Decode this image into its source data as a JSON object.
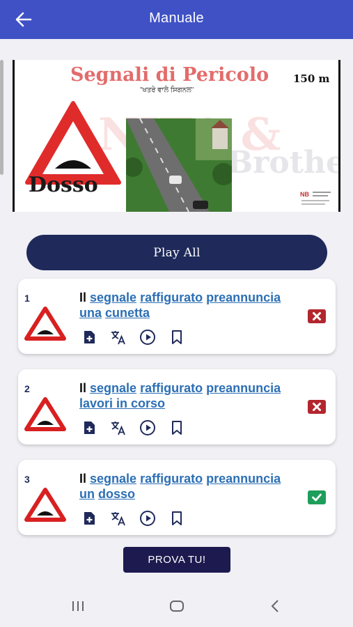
{
  "header": {
    "title": "Manuale"
  },
  "banner": {
    "title": "Segnali di Pericolo",
    "distance": "150 m",
    "subtitle": "\"ਖਤਰੇ ਵਾਲੇ ਸਿਗਨਲ\"",
    "sign_label": "Dosso",
    "watermark_line1": "NITA &",
    "watermark_line2": "Brothers"
  },
  "play_all_label": "Play All",
  "questions": [
    {
      "number": "1",
      "prefix": "Il",
      "words": [
        "segnale",
        "raffigurato",
        "preannuncia",
        "una",
        "cunetta"
      ],
      "status": "wrong"
    },
    {
      "number": "2",
      "prefix": "Il",
      "words": [
        "segnale",
        "raffigurato",
        "preannuncia",
        "lavori in corso"
      ],
      "status": "wrong"
    },
    {
      "number": "3",
      "prefix": "Il",
      "words": [
        "segnale",
        "raffigurato",
        "preannuncia",
        "un",
        "dosso"
      ],
      "status": "correct"
    }
  ],
  "prova_label": "PROVA TU!",
  "colors": {
    "appbar": "#3f51c5",
    "primary_dark": "#1f2a5a",
    "wrong": "#b3262e",
    "correct": "#1e9e5a",
    "link": "#2c6fb5"
  },
  "icons": [
    "back-arrow-icon",
    "add-note-icon",
    "translate-icon",
    "play-circle-icon",
    "bookmark-icon",
    "wrong-icon",
    "correct-icon",
    "recent-apps-icon",
    "home-icon",
    "back-nav-icon"
  ]
}
